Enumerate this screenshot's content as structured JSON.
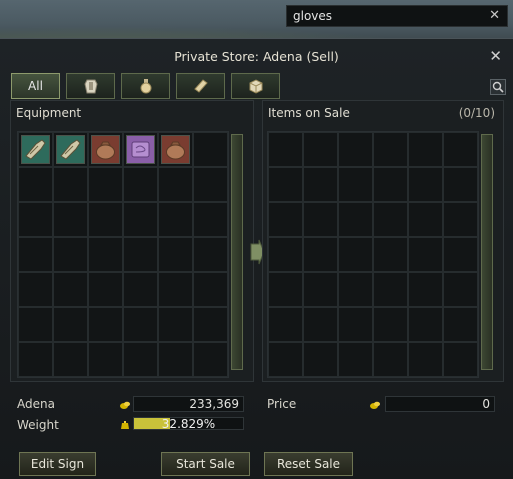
{
  "search": {
    "value": "gloves",
    "clear_icon": "close-icon"
  },
  "window": {
    "title": "Private Store: Adena (Sell)",
    "close_icon": "close-icon"
  },
  "tabs": [
    {
      "label": "All",
      "active": true
    },
    {
      "icon": "armor-icon"
    },
    {
      "icon": "potion-icon"
    },
    {
      "icon": "scroll-icon"
    },
    {
      "icon": "box-icon"
    }
  ],
  "equipment": {
    "header": "Equipment",
    "items": [
      {
        "icon": "gloves-icon",
        "color": "#2e6b5c"
      },
      {
        "icon": "gloves-icon",
        "color": "#2e6b5c"
      },
      {
        "icon": "pouch-icon",
        "color": "#7a3c30"
      },
      {
        "icon": "cloth-icon",
        "color": "#8a5fa8"
      },
      {
        "icon": "pouch-icon",
        "color": "#7a3c30"
      }
    ]
  },
  "sale": {
    "header": "Items on Sale",
    "count": "(0/10)"
  },
  "stats": {
    "adena_label": "Adena",
    "adena_value": "233,369",
    "weight_label": "Weight",
    "weight_value": "32.829%",
    "weight_fraction": 0.328,
    "price_label": "Price",
    "price_value": "0"
  },
  "buttons": {
    "edit_sign": "Edit Sign",
    "start_sale": "Start Sale",
    "reset_sale": "Reset Sale"
  },
  "colors": {
    "accent": "#c9c23a",
    "coin": "#d4b400"
  }
}
